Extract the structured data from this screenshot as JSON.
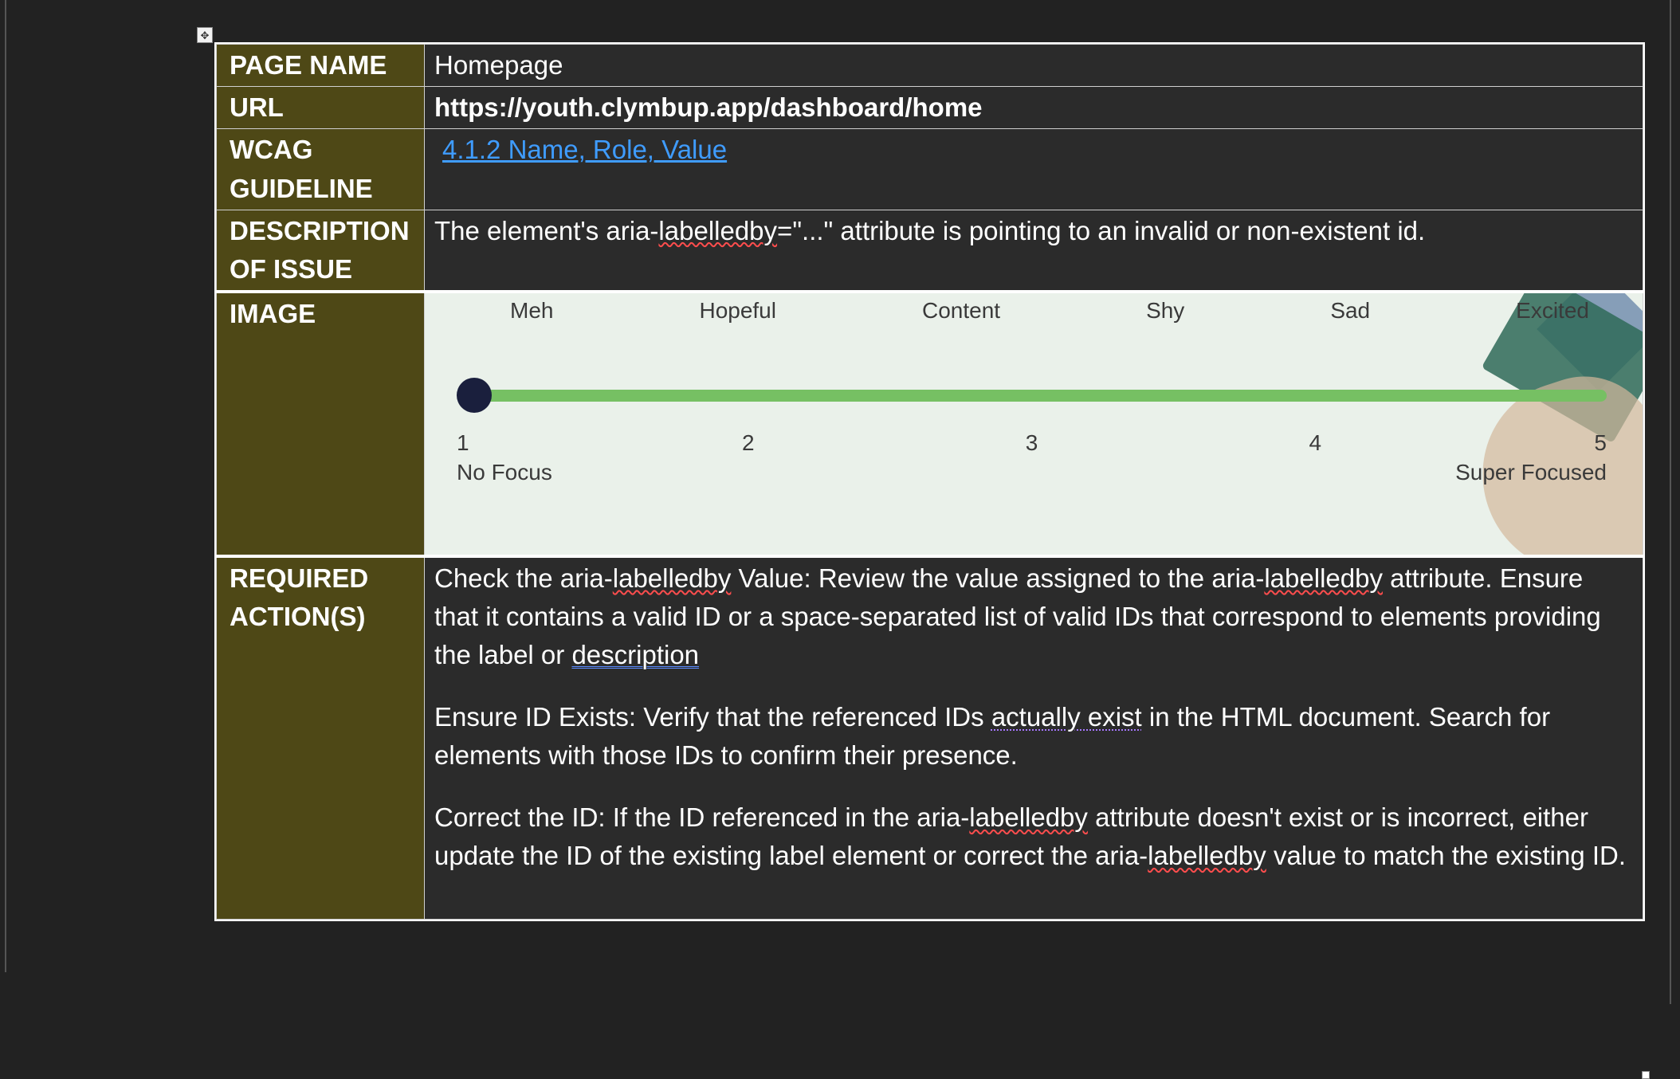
{
  "rows": {
    "page_name": {
      "label": "PAGE NAME",
      "value": "Homepage"
    },
    "url": {
      "label": "URL",
      "value": "https://youth.clymbup.app/dashboard/home"
    },
    "wcag": {
      "label_l1": "WCAG",
      "label_l2": "GUIDELINE",
      "link": "4.1.2 Name, Role, Value"
    },
    "description": {
      "label_l1": "DESCRIPTION",
      "label_l2": "OF ISSUE",
      "pre": "The element's aria-",
      "wave": "labelledby",
      "post": "=\"...\" attribute is pointing to an invalid or non-existent id."
    },
    "image": {
      "label": "IMAGE"
    },
    "actions": {
      "label_l1": "REQUIRED",
      "label_l2": "ACTION(S)"
    }
  },
  "slider": {
    "emotions": [
      "Meh",
      "Hopeful",
      "Content",
      "Shy",
      "Sad",
      "Excited"
    ],
    "ticks": [
      "1",
      "2",
      "3",
      "4",
      "5"
    ],
    "min_label": "No Focus",
    "max_label": "Super Focused"
  },
  "actions": {
    "p1": {
      "t1": "Check the aria-",
      "w1": "labelledby",
      "t2": " Value: Review the value assigned to the aria-",
      "w2": "labelledby",
      "t3": " attribute. Ensure that it contains a valid ID or a space-separated list of valid IDs that correspond to elements providing the label or ",
      "b1": "description"
    },
    "p2": {
      "t1": "Ensure ID Exists: Verify that the referenced IDs ",
      "d1": "actually exist",
      "t2": " in the HTML document. Search for elements with those IDs to confirm their presence."
    },
    "p3": {
      "t1": "Correct the ID: If the ID referenced in the aria-",
      "w1": "labelledby",
      "t2": " attribute doesn't exist or is incorrect, either update the ID of the existing label element or correct the aria-",
      "w2": "labelledby",
      "t3": " value to match the existing ID."
    }
  }
}
